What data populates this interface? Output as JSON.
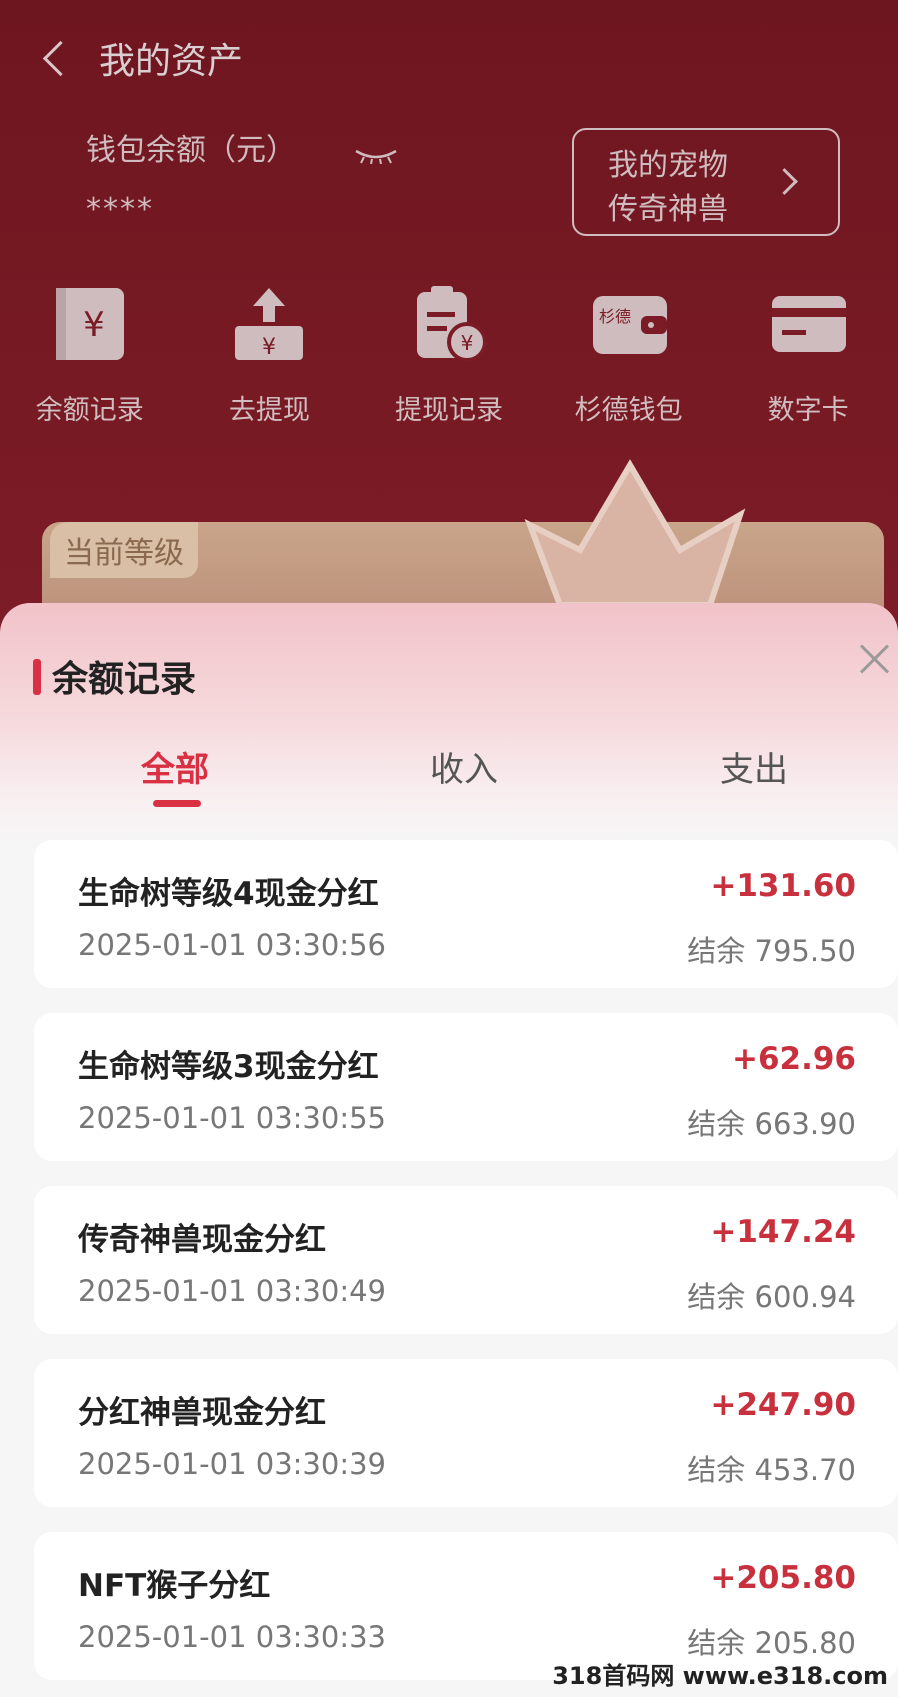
{
  "header": {
    "title": "我的资产"
  },
  "wallet": {
    "label": "钱包余额（元）",
    "masked": "****"
  },
  "pet_button": {
    "line1": "我的宠物",
    "line2": "传奇神兽"
  },
  "actions": [
    {
      "label": "余额记录",
      "icon": "receipt-yuan-icon"
    },
    {
      "label": "去提现",
      "icon": "withdraw-tray-icon"
    },
    {
      "label": "提现记录",
      "icon": "clipboard-yuan-icon"
    },
    {
      "label": "杉德钱包",
      "icon": "wallet-icon",
      "icon_text": "杉德"
    },
    {
      "label": "数字卡",
      "icon": "card-icon"
    }
  ],
  "level_card": {
    "label": "当前等级"
  },
  "sheet": {
    "title": "余额记录",
    "tabs": [
      "全部",
      "收入",
      "支出"
    ],
    "active_tab": "全部"
  },
  "records": [
    {
      "name": "生命树等级4现金分红",
      "amount": "+131.60",
      "time": "2025-01-01 03:30:56",
      "balance": "结余 795.50"
    },
    {
      "name": "生命树等级3现金分红",
      "amount": "+62.96",
      "time": "2025-01-01 03:30:55",
      "balance": "结余 663.90"
    },
    {
      "name": "传奇神兽现金分红",
      "amount": "+147.24",
      "time": "2025-01-01 03:30:49",
      "balance": "结余 600.94"
    },
    {
      "name": "分红神兽现金分红",
      "amount": "+247.90",
      "time": "2025-01-01 03:30:39",
      "balance": "结余 453.70"
    },
    {
      "name": "NFT猴子分红",
      "amount": "+205.80",
      "time": "2025-01-01 03:30:33",
      "balance": "结余 205.80"
    }
  ],
  "watermark": "318首码网 www.e318.com",
  "colors": {
    "header_bg": "#7a1b25",
    "accent": "#d93043",
    "amount": "#c9303d"
  }
}
